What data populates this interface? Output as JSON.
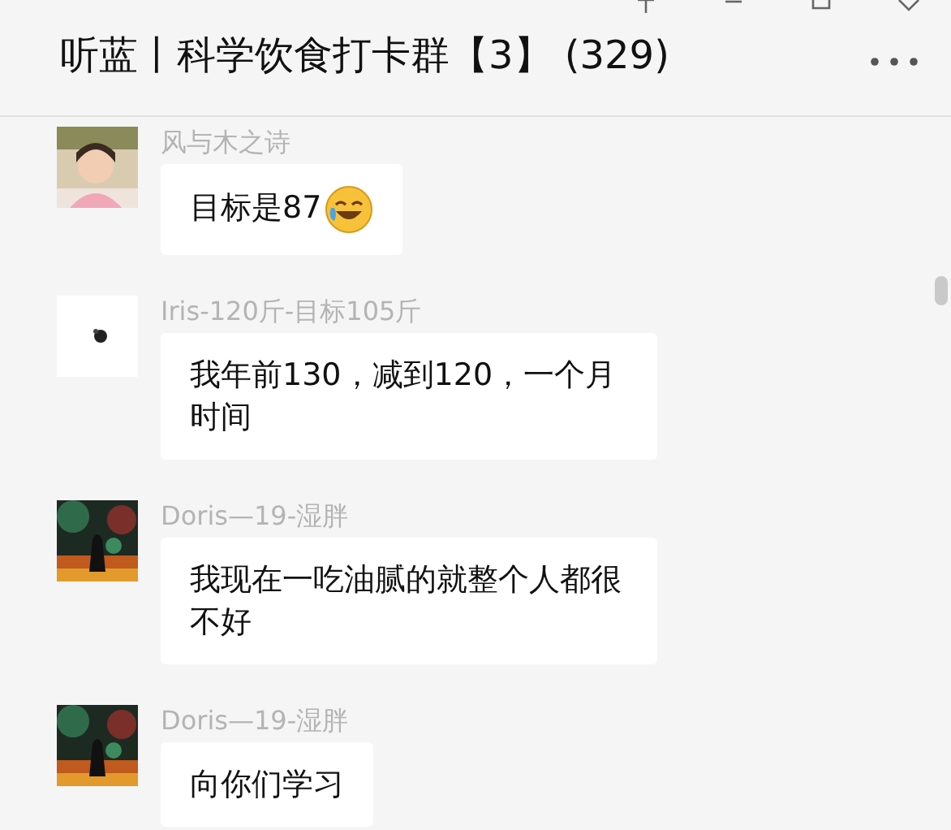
{
  "window": {
    "title": "听蓝丨科学饮食打卡群【3】 (329)"
  },
  "messages": [
    {
      "sender": "风与木之诗",
      "text": "目标是87",
      "has_emoji": true
    },
    {
      "sender": "Iris-120斤-目标105斤",
      "avatar": {
        "kind": "logo"
      },
      "text": "我年前130，减到120，一个月时间",
      "has_emoji": false
    },
    {
      "sender": "Doris—19-湿胖",
      "avatar": {
        "kind": "art"
      },
      "text": "我现在一吃油腻的就整个人都很不好",
      "has_emoji": false
    },
    {
      "sender": "Doris—19-湿胖",
      "avatar": {
        "kind": "art"
      },
      "text": "向你们学习",
      "has_emoji": false
    }
  ]
}
